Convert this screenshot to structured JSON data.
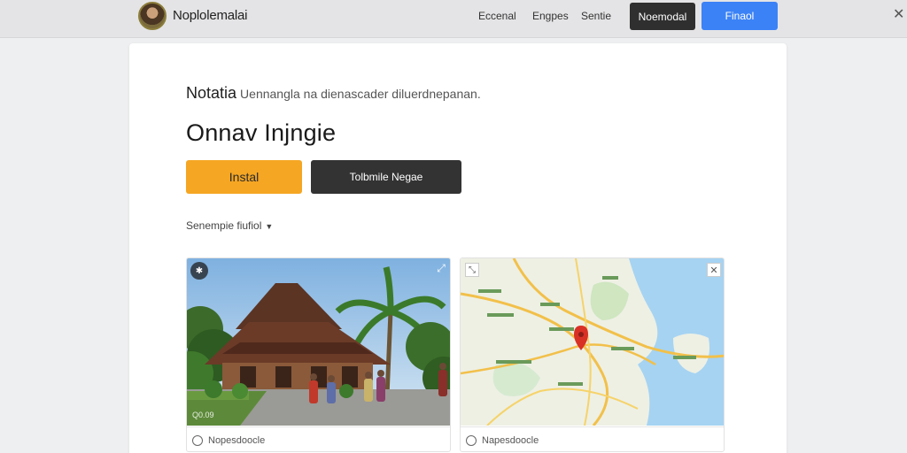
{
  "header": {
    "app_title": "Noplolemalai",
    "nav": [
      "Eccenal",
      "Engpes",
      "Sentie"
    ],
    "dark_button": "Noemodal",
    "blue_button": "Finaol"
  },
  "main": {
    "subline_bold": "Notatia",
    "subline_muted": "Uennangla na dienascader diluerdnepanan.",
    "headline": "Onnav Injngie",
    "primary_button": "Instal",
    "secondary_button": "Tolbmile Negae",
    "dropdown_label": "Senempie fiufiol",
    "cards": [
      {
        "caption": "Nopesdoocle",
        "photo_stamp": "Q0.09"
      },
      {
        "caption": "Napesdoocle"
      }
    ]
  },
  "colors": {
    "orange": "#f5a623",
    "blue": "#3b82f6",
    "dark": "#333333",
    "map_pin": "#d93025"
  },
  "icons": {
    "close": "close-icon",
    "caption": "comment-icon",
    "expand": "expand-icon",
    "pin": "map-pin-icon"
  }
}
